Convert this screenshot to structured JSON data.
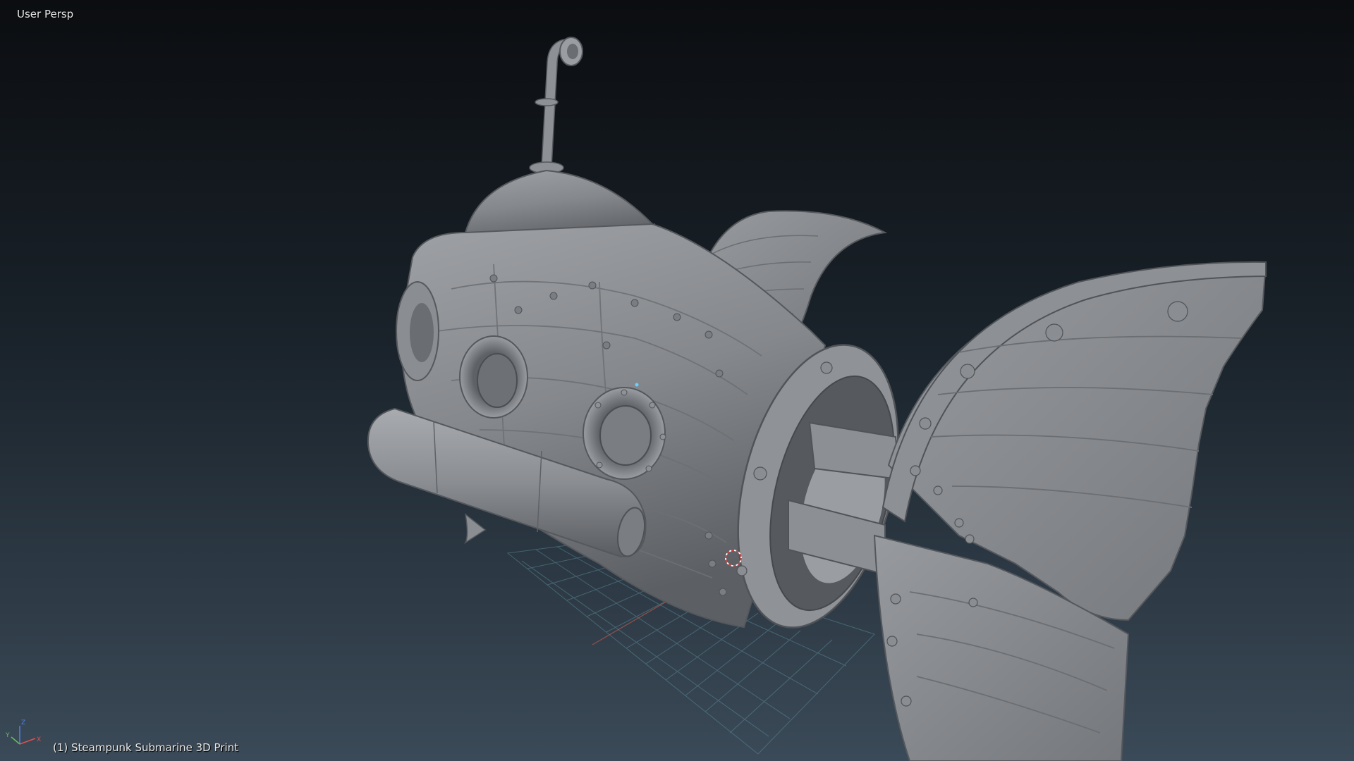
{
  "viewport": {
    "view_label": "User Persp",
    "object_label": "(1) Steampunk Submarine 3D Print",
    "background_top": "#0b0d10",
    "background_bottom": "#3b4a58",
    "grid_color": "#5a8a94"
  },
  "model": {
    "name": "Steampunk Submarine 3D Print",
    "material_color": "#8a8d91"
  },
  "axis_gizmo": {
    "x_label": "X",
    "y_label": "Y",
    "z_label": "Z",
    "x_color": "#e05050",
    "y_color": "#60c060",
    "z_color": "#5080e0"
  }
}
